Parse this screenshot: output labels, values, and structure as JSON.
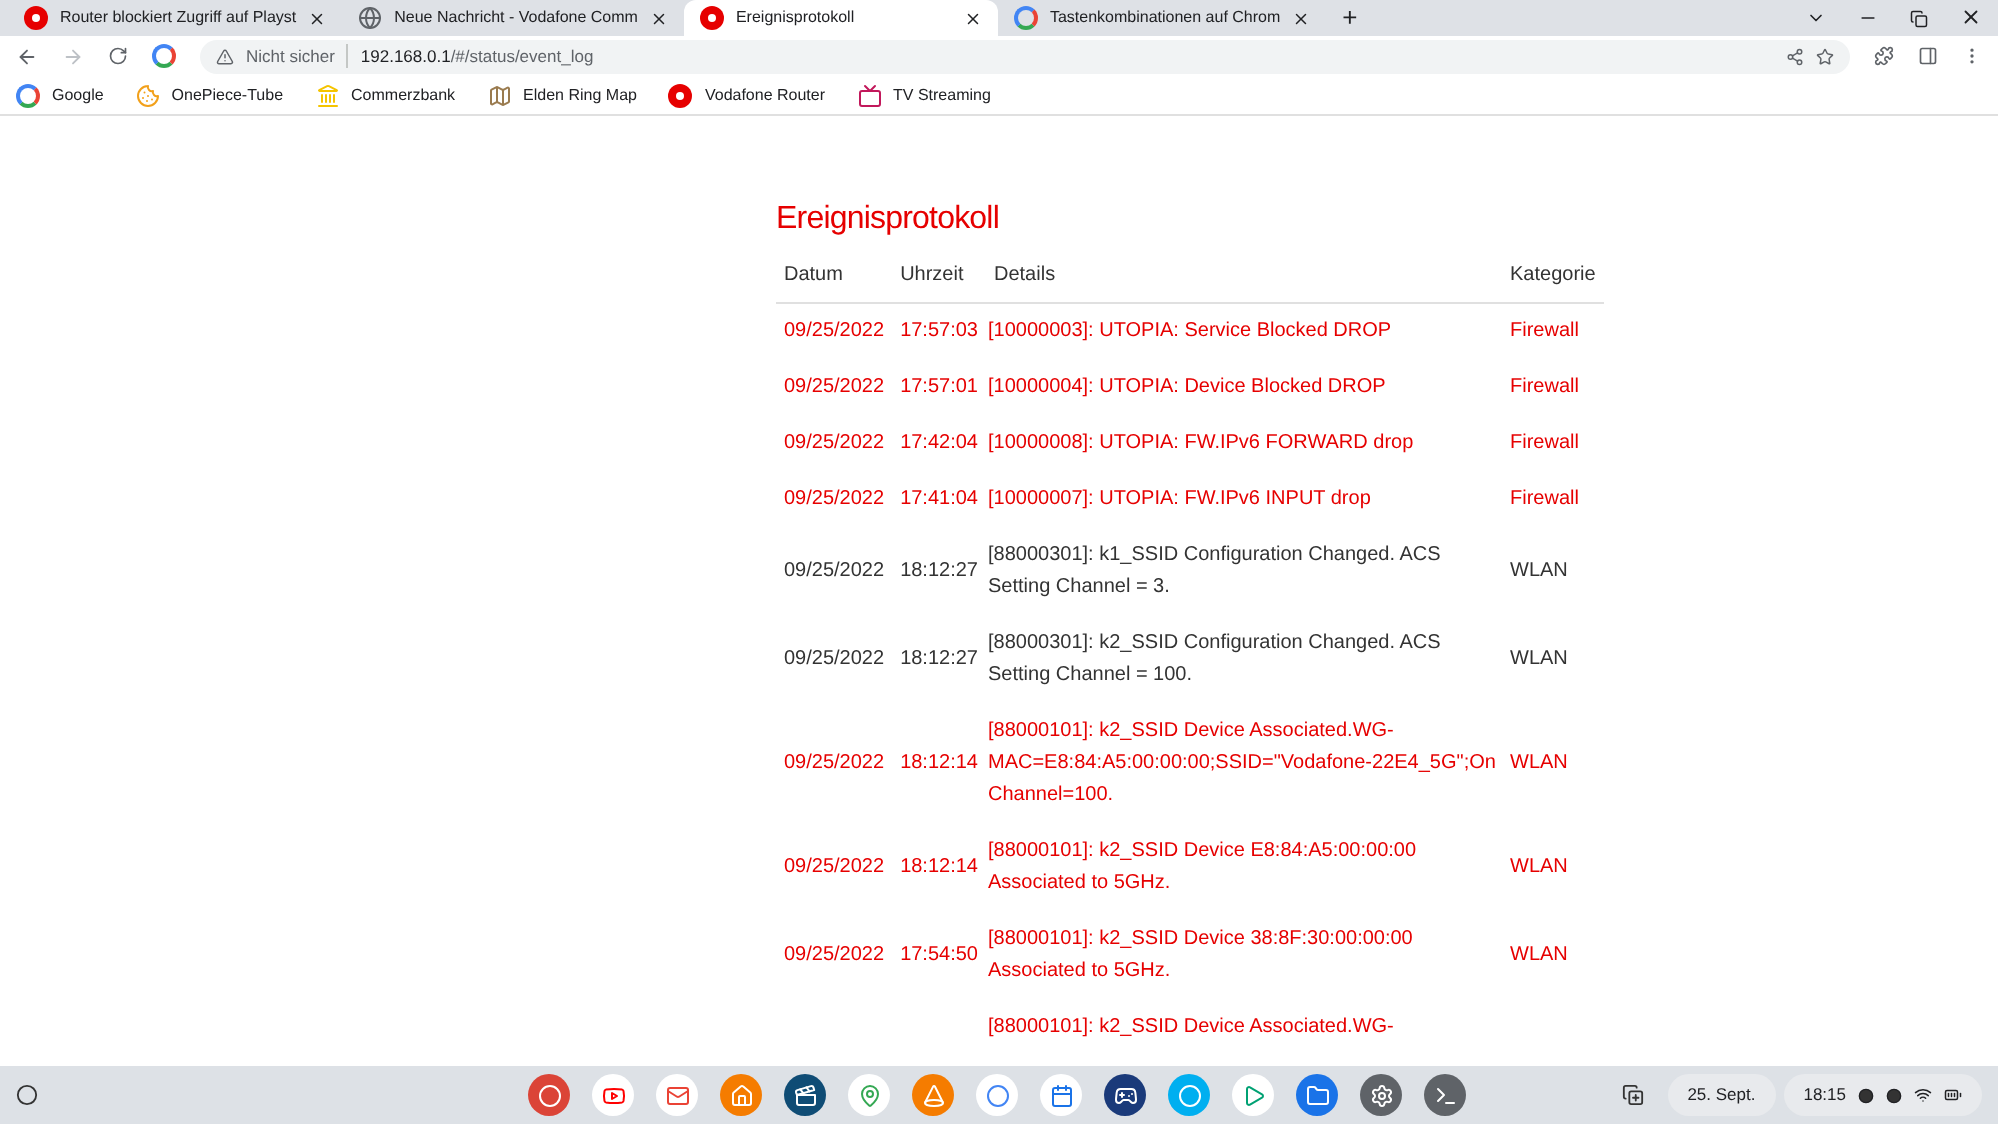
{
  "browser": {
    "tabs": [
      {
        "title": "Router blockiert Zugriff auf Playst",
        "selected": false
      },
      {
        "title": "Neue Nachricht - Vodafone Comm",
        "selected": false
      },
      {
        "title": "Ereignisprotokoll",
        "selected": true
      },
      {
        "title": "Tastenkombinationen auf Chrom",
        "selected": false
      }
    ],
    "new_tab": "+",
    "address": {
      "security": "Nicht sicher",
      "host": "192.168.0.1",
      "path": "/#/status/event_log"
    },
    "bookmarks": [
      "Google",
      "OnePiece-Tube",
      "Commerzbank",
      "Elden Ring Map",
      "Vodafone Router",
      "TV Streaming"
    ]
  },
  "page": {
    "title": "Ereignisprotokoll",
    "table": {
      "columns": [
        "Datum",
        "Uhrzeit",
        "Details",
        "Kategorie"
      ],
      "rows": [
        {
          "kind": "alert",
          "date": "09/25/2022",
          "time": "17:57:03",
          "details": "[10000003]: UTOPIA: Service Blocked DROP",
          "category": "Firewall"
        },
        {
          "kind": "alert",
          "date": "09/25/2022",
          "time": "17:57:01",
          "details": "[10000004]: UTOPIA: Device Blocked DROP",
          "category": "Firewall"
        },
        {
          "kind": "alert",
          "date": "09/25/2022",
          "time": "17:42:04",
          "details": "[10000008]: UTOPIA: FW.IPv6 FORWARD drop",
          "category": "Firewall"
        },
        {
          "kind": "alert",
          "date": "09/25/2022",
          "time": "17:41:04",
          "details": "[10000007]: UTOPIA: FW.IPv6 INPUT drop",
          "category": "Firewall"
        },
        {
          "kind": "info",
          "date": "09/25/2022",
          "time": "18:12:27",
          "details": "[88000301]: k1_SSID Configuration Changed. ACS Setting Channel = 3.",
          "category": "WLAN"
        },
        {
          "kind": "info",
          "date": "09/25/2022",
          "time": "18:12:27",
          "details": "[88000301]: k2_SSID Configuration Changed. ACS Setting Channel = 100.",
          "category": "WLAN"
        },
        {
          "kind": "alert",
          "date": "09/25/2022",
          "time": "18:12:14",
          "details": "[88000101]: k2_SSID Device Associated.WG-MAC=E8:84:A5:00:00:00;SSID=\"Vodafone-22E4_5G\";On Channel=100.",
          "category": "WLAN"
        },
        {
          "kind": "alert",
          "date": "09/25/2022",
          "time": "18:12:14",
          "details": "[88000101]: k2_SSID Device E8:84:A5:00:00:00 Associated to 5GHz.",
          "category": "WLAN"
        },
        {
          "kind": "alert",
          "date": "09/25/2022",
          "time": "17:54:50",
          "details": "[88000101]: k2_SSID Device 38:8F:30:00:00:00 Associated to 5GHz.",
          "category": "WLAN"
        },
        {
          "kind": "alert",
          "details": "[88000101]: k2_SSID Device Associated.WG-"
        }
      ]
    }
  },
  "shelf": {
    "date": "25. Sept.",
    "time": "18:15"
  }
}
